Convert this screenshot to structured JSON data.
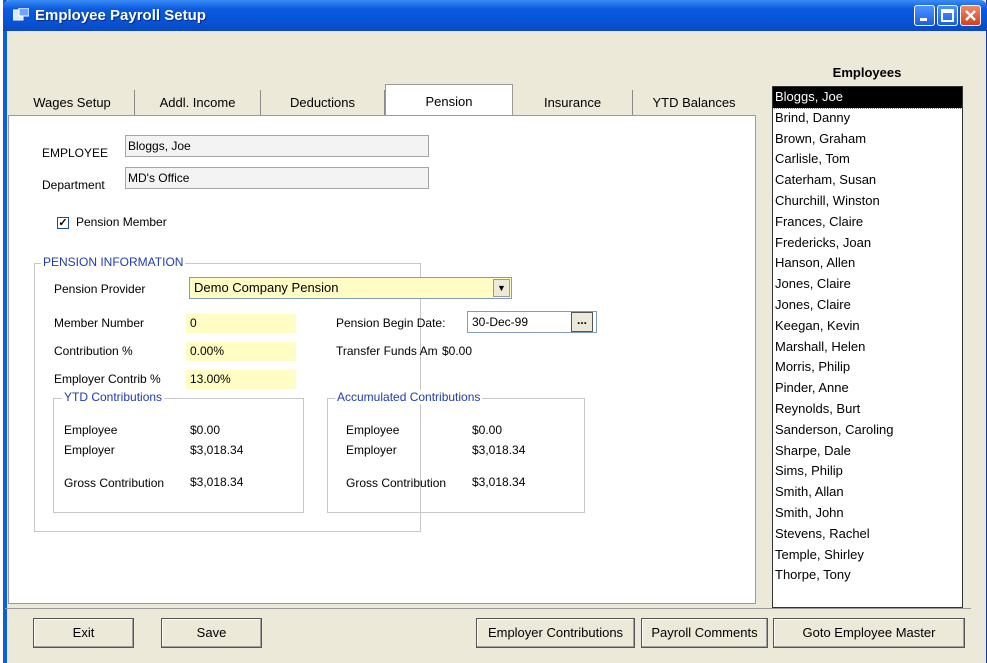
{
  "window": {
    "title": "Employee Payroll Setup"
  },
  "tabs": [
    {
      "label": "Wages Setup"
    },
    {
      "label": "Addl. Income"
    },
    {
      "label": "Deductions"
    },
    {
      "label": "Pension"
    },
    {
      "label": "Insurance"
    },
    {
      "label": "YTD Balances"
    }
  ],
  "employee": {
    "label": "EMPLOYEE",
    "value": "Bloggs, Joe",
    "department_label": "Department",
    "department_value": "MD's Office"
  },
  "pension_member": {
    "label": "Pension Member",
    "checked": true
  },
  "pension_info": {
    "title": "PENSION INFORMATION",
    "provider_label": "Pension Provider",
    "provider_value": "Demo Company Pension",
    "member_number_label": "Member Number",
    "member_number_value": "0",
    "contribution_label": "Contribution %",
    "contribution_value": "0.00%",
    "employer_contrib_label": "Employer Contrib %",
    "employer_contrib_value": "13.00%",
    "begin_date_label": "Pension Begin Date:",
    "begin_date_value": "30-Dec-99",
    "transfer_label": "Transfer Funds Amt.",
    "transfer_value": "$0.00"
  },
  "ytd": {
    "title": "YTD Contributions",
    "employee_label": "Employee",
    "employee_value": "$0.00",
    "employer_label": "Employer",
    "employer_value": "$3,018.34",
    "gross_label": "Gross Contribution",
    "gross_value": "$3,018.34"
  },
  "accumulated": {
    "title": "Accumulated Contributions",
    "employee_label": "Employee",
    "employee_value": "$0.00",
    "employer_label": "Employer",
    "employer_value": "$3,018.34",
    "gross_label": "Gross Contribution",
    "gross_value": "$3,018.34"
  },
  "employees": {
    "title": "Employees",
    "items": [
      "Bloggs, Joe",
      "Brind, Danny",
      "Brown, Graham",
      "Carlisle, Tom",
      "Caterham, Susan",
      "Churchill, Winston",
      "Frances, Claire",
      "Fredericks, Joan",
      "Hanson, Allen",
      "Jones, Claire",
      "Jones, Claire",
      "Keegan, Kevin",
      "Marshall, Helen",
      "Morris, Philip",
      "Pinder, Anne",
      "Reynolds, Burt",
      "Sanderson, Caroling",
      "Sharpe, Dale",
      "Sims, Philip",
      "Smith, Allan",
      "Smith, John",
      "Stevens, Rachel",
      "Temple, Shirley",
      "Thorpe, Tony"
    ],
    "selected_index": 0
  },
  "buttons": {
    "exit": "Exit",
    "save": "Save",
    "employer_contributions": "Employer Contributions",
    "payroll_comments": "Payroll Comments",
    "goto_employee_master": "Goto Employee Master"
  },
  "colors": {
    "titlebar": "#0a5ae0",
    "field_yellow": "#fffdc4",
    "group_title": "#1f3cae"
  }
}
